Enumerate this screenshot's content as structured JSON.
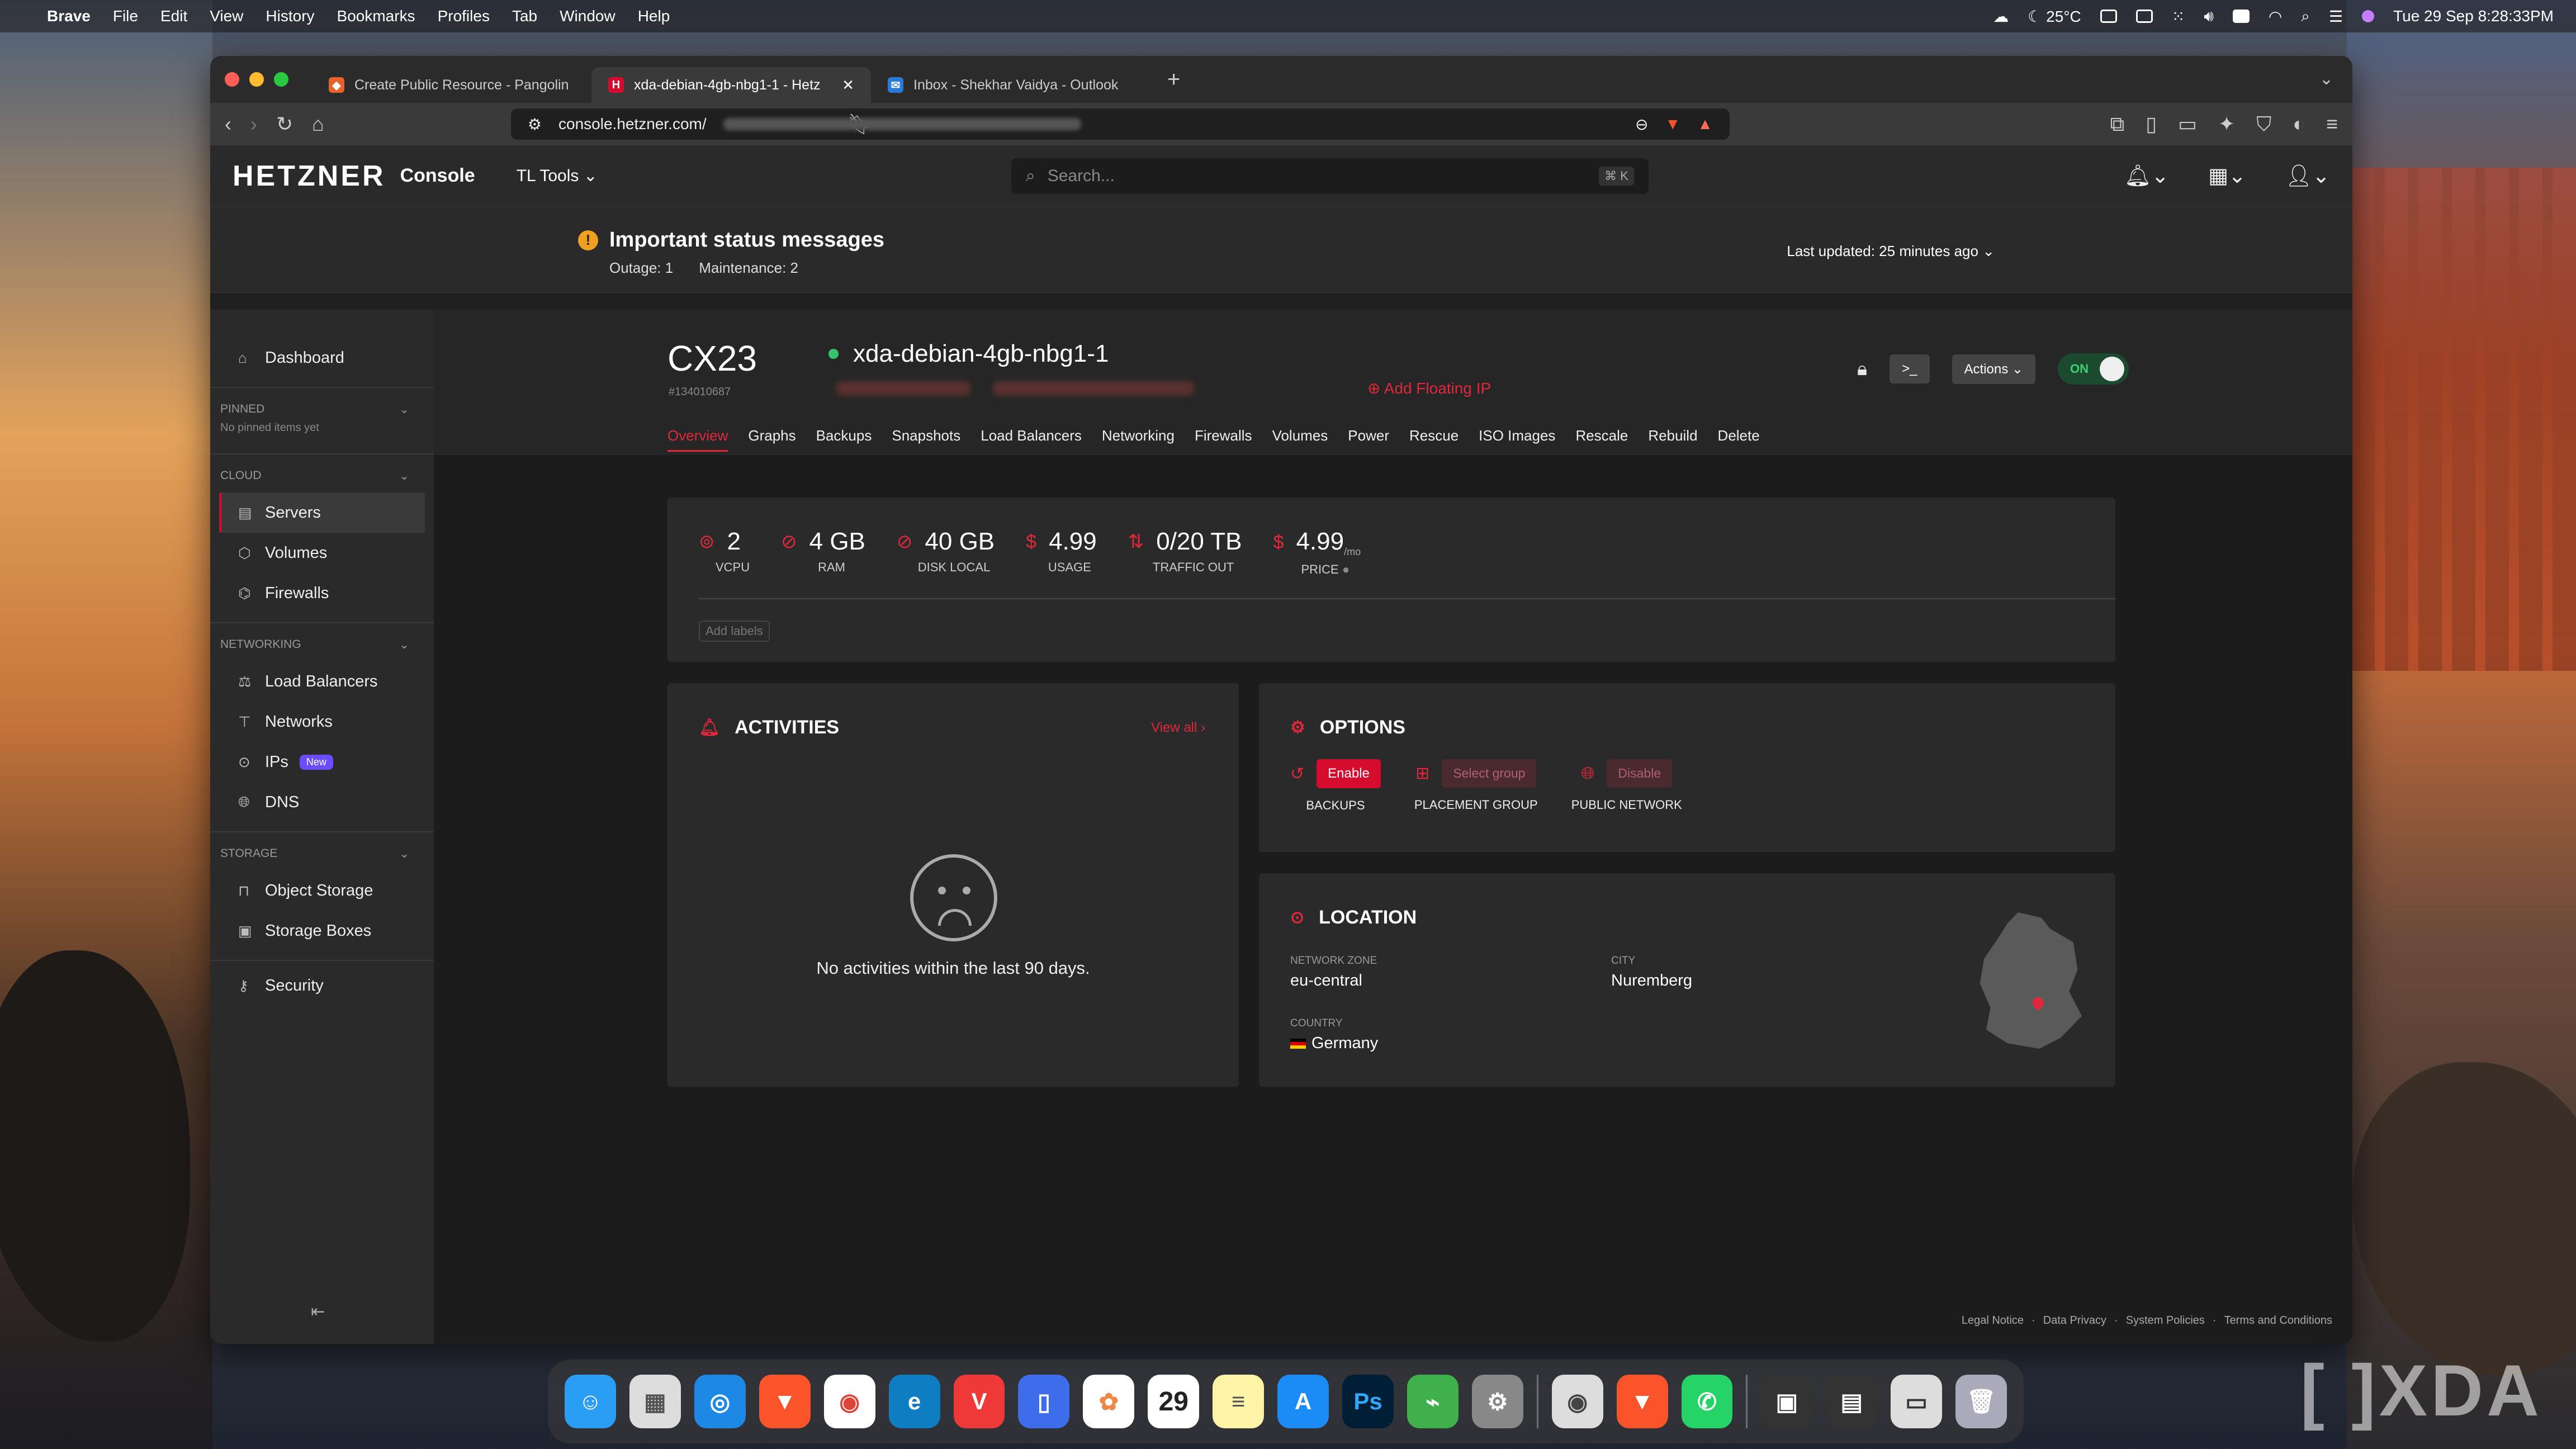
{
  "menubar": {
    "app": "Brave",
    "items": [
      "File",
      "Edit",
      "View",
      "History",
      "Bookmarks",
      "Profiles",
      "Tab",
      "Window",
      "Help"
    ],
    "weather": "25°C",
    "clock": "Tue 29 Sep  8:28:33PM"
  },
  "tabs": [
    {
      "label": "Create Public Resource - Pangolin",
      "color": "#e8602c",
      "glyph": "◆"
    },
    {
      "label": "xda-debian-4gb-nbg1-1 - Hetz",
      "color": "#d50c2d",
      "glyph": "H"
    },
    {
      "label": "Inbox - Shekhar Vaidya - Outlook",
      "color": "#2a7bd6",
      "glyph": "✉"
    }
  ],
  "address": {
    "url": "console.hetzner.com/"
  },
  "app": {
    "logo": "HETZNER",
    "console": "Console",
    "project": "TL Tools",
    "search_placeholder": "Search...",
    "search_kbd": "⌘ K"
  },
  "status": {
    "title": "Important status messages",
    "outage": "Outage: 1",
    "maintenance": "Maintenance: 2",
    "updated": "Last updated: 25 minutes ago"
  },
  "sidebar": {
    "dashboard": "Dashboard",
    "pinned": "PINNED",
    "pinned_note": "No pinned items yet",
    "cloud": "CLOUD",
    "cloud_items": [
      "Servers",
      "Volumes",
      "Firewalls"
    ],
    "networking": "NETWORKING",
    "net_items": [
      "Load Balancers",
      "Networks",
      "IPs",
      "DNS"
    ],
    "new_badge": "New",
    "storage": "STORAGE",
    "storage_items": [
      "Object Storage",
      "Storage Boxes"
    ],
    "security": "Security"
  },
  "server": {
    "type": "CX23",
    "id": "#134010687",
    "name": "xda-debian-4gb-nbg1-1",
    "add_floating_ip": "Add Floating IP",
    "tabs": [
      "Overview",
      "Graphs",
      "Backups",
      "Snapshots",
      "Load Balancers",
      "Networking",
      "Firewalls",
      "Volumes",
      "Power",
      "Rescue",
      "ISO Images",
      "Rescale",
      "Rebuild",
      "Delete"
    ],
    "actions": "Actions",
    "power": "ON"
  },
  "specs": [
    {
      "value": "2",
      "label": "VCPU",
      "icon": "cpu-icon"
    },
    {
      "value": "4 GB",
      "label": "RAM",
      "icon": "ram-icon"
    },
    {
      "value": "40 GB",
      "label": "DISK LOCAL",
      "icon": "disk-icon"
    },
    {
      "value": "4.99",
      "label": "USAGE",
      "icon": "dollar-icon"
    },
    {
      "value": "0/20 TB",
      "label": "TRAFFIC OUT",
      "icon": "traffic-icon"
    },
    {
      "value": "4.99",
      "label": "PRICE",
      "icon": "dollar-icon",
      "suffix": "/mo"
    }
  ],
  "add_labels": "Add labels",
  "activities": {
    "title": "ACTIVITIES",
    "view_all": "View all",
    "empty": "No activities within the last 90 days."
  },
  "options": {
    "title": "OPTIONS",
    "backups": {
      "button": "Enable",
      "label": "BACKUPS"
    },
    "placement": {
      "button": "Select group",
      "label": "PLACEMENT GROUP"
    },
    "public": {
      "button": "Disable",
      "label": "PUBLIC NETWORK"
    }
  },
  "location": {
    "title": "LOCATION",
    "zone_label": "NETWORK ZONE",
    "zone": "eu-central",
    "city_label": "CITY",
    "city": "Nuremberg",
    "country_label": "COUNTRY",
    "country": "Germany"
  },
  "footer": [
    "Legal Notice",
    "Data Privacy",
    "System Policies",
    "Terms and Conditions"
  ],
  "dock": {
    "date": "29",
    "watermark": "XDA"
  }
}
